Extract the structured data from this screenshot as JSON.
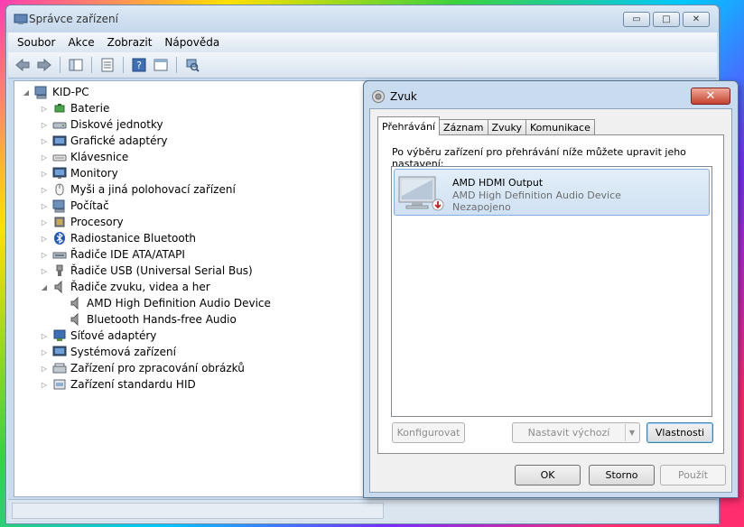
{
  "window": {
    "title": "Správce zařízení",
    "buttons": {
      "minimize": "▭",
      "maximize": "□",
      "close": "✕"
    }
  },
  "menu": [
    "Soubor",
    "Akce",
    "Zobrazit",
    "Nápověda"
  ],
  "tree": {
    "root": "KID-PC",
    "items": [
      {
        "label": "Baterie",
        "icon": "battery-icon"
      },
      {
        "label": "Diskové jednotky",
        "icon": "disk-drive-icon"
      },
      {
        "label": "Grafické adaptéry",
        "icon": "display-adapter-icon"
      },
      {
        "label": "Klávesnice",
        "icon": "keyboard-icon"
      },
      {
        "label": "Monitory",
        "icon": "monitor-icon"
      },
      {
        "label": "Myši a jiná polohovací zařízení",
        "icon": "mouse-icon"
      },
      {
        "label": "Počítač",
        "icon": "computer-icon"
      },
      {
        "label": "Procesory",
        "icon": "processor-icon"
      },
      {
        "label": "Radiostanice Bluetooth",
        "icon": "bluetooth-icon"
      },
      {
        "label": "Řadiče IDE ATA/ATAPI",
        "icon": "ide-controller-icon"
      },
      {
        "label": "Řadiče USB (Universal Serial Bus)",
        "icon": "usb-icon"
      },
      {
        "label": "Řadiče zvuku, videa a her",
        "icon": "speaker-icon"
      },
      {
        "label": "AMD High Definition Audio Device",
        "icon": "speaker-icon",
        "child": true
      },
      {
        "label": "Bluetooth Hands-free Audio",
        "icon": "speaker-icon",
        "child": true
      },
      {
        "label": "Síťové adaptéry",
        "icon": "network-adapter-icon"
      },
      {
        "label": "Systémová zařízení",
        "icon": "system-device-icon"
      },
      {
        "label": "Zařízení pro zpracování obrázků",
        "icon": "imaging-device-icon"
      },
      {
        "label": "Zařízení standardu HID",
        "icon": "hid-icon"
      }
    ]
  },
  "dialog": {
    "title": "Zvuk",
    "close": "✕",
    "tabs": [
      "Přehrávání",
      "Záznam",
      "Zvuky",
      "Komunikace"
    ],
    "instruction": "Po výběru zařízení pro přehrávání níže můžete upravit jeho nastavení:",
    "device": {
      "name": "AMD HDMI Output",
      "description": "AMD High Definition Audio Device",
      "status": "Nezapojeno"
    },
    "buttons": {
      "configure": "Konfigurovat",
      "set_default": "Nastavit výchozí",
      "properties": "Vlastnosti",
      "ok": "OK",
      "cancel": "Storno",
      "apply": "Použít"
    }
  }
}
